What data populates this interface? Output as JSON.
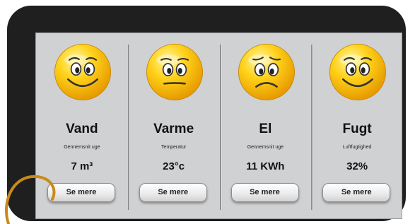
{
  "tiles": [
    {
      "title": "Vand",
      "subtitle": "Gennemsnit uge",
      "value": "7 m³",
      "button": "Se mere",
      "mood": "happy",
      "icon": "smiley-happy-icon"
    },
    {
      "title": "Varme",
      "subtitle": "Temperatur",
      "value": "23°c",
      "button": "Se mere",
      "mood": "neutral",
      "icon": "smiley-neutral-icon"
    },
    {
      "title": "El",
      "subtitle": "Gennemsnit uge",
      "value": "11 KWh",
      "button": "Se mere",
      "mood": "sad",
      "icon": "smiley-sad-icon"
    },
    {
      "title": "Fugt",
      "subtitle": "Luftfugtighed",
      "value": "32%",
      "button": "Se mere",
      "mood": "happy",
      "icon": "smiley-happy-icon"
    }
  ],
  "colors": {
    "frame": "#1f1f1f",
    "screen": "#cfd1d2",
    "face": "#f6c200",
    "cable": "#c98a1a"
  }
}
